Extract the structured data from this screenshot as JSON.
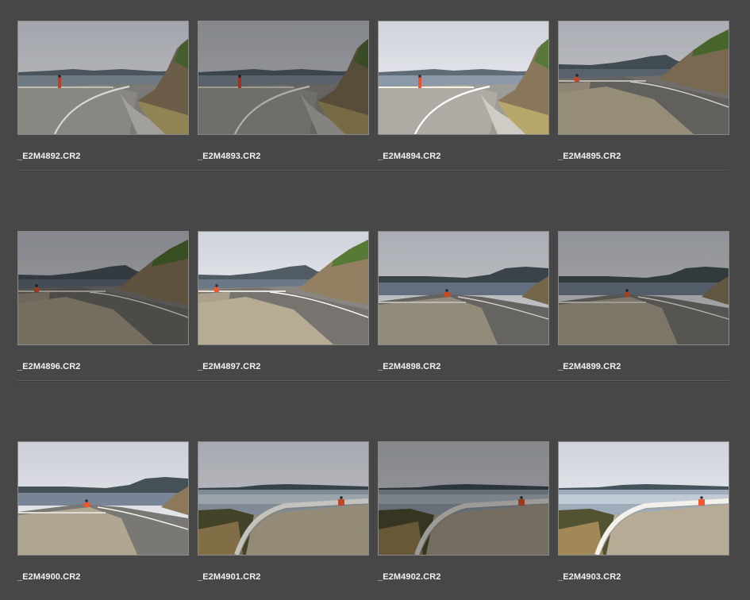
{
  "filmstrip": {
    "rows": [
      [
        {
          "filename": "_E2M4892.CR2",
          "scene": "A",
          "exposure": 0.88
        },
        {
          "filename": "_E2M4893.CR2",
          "scene": "A",
          "exposure": 0.72
        },
        {
          "filename": "_E2M4894.CR2",
          "scene": "A",
          "exposure": 1.12
        },
        {
          "filename": "_E2M4895.CR2",
          "scene": "B",
          "exposure": 0.92
        }
      ],
      [
        {
          "filename": "_E2M4896.CR2",
          "scene": "B",
          "exposure": 0.72
        },
        {
          "filename": "_E2M4897.CR2",
          "scene": "B",
          "exposure": 1.12
        },
        {
          "filename": "_E2M4898.CR2",
          "scene": "C",
          "exposure": 0.92
        },
        {
          "filename": "_E2M4899.CR2",
          "scene": "C",
          "exposure": 0.78
        }
      ],
      [
        {
          "filename": "_E2M4900.CR2",
          "scene": "C",
          "exposure": 1.1
        },
        {
          "filename": "_E2M4901.CR2",
          "scene": "D",
          "exposure": 0.9
        },
        {
          "filename": "_E2M4902.CR2",
          "scene": "D",
          "exposure": 0.72
        },
        {
          "filename": "_E2M4903.CR2",
          "scene": "D",
          "exposure": 1.12
        }
      ]
    ]
  },
  "colors": {
    "background": "#474747",
    "label": "#f2f2f2",
    "thumb_border": "#8a8a8a"
  }
}
